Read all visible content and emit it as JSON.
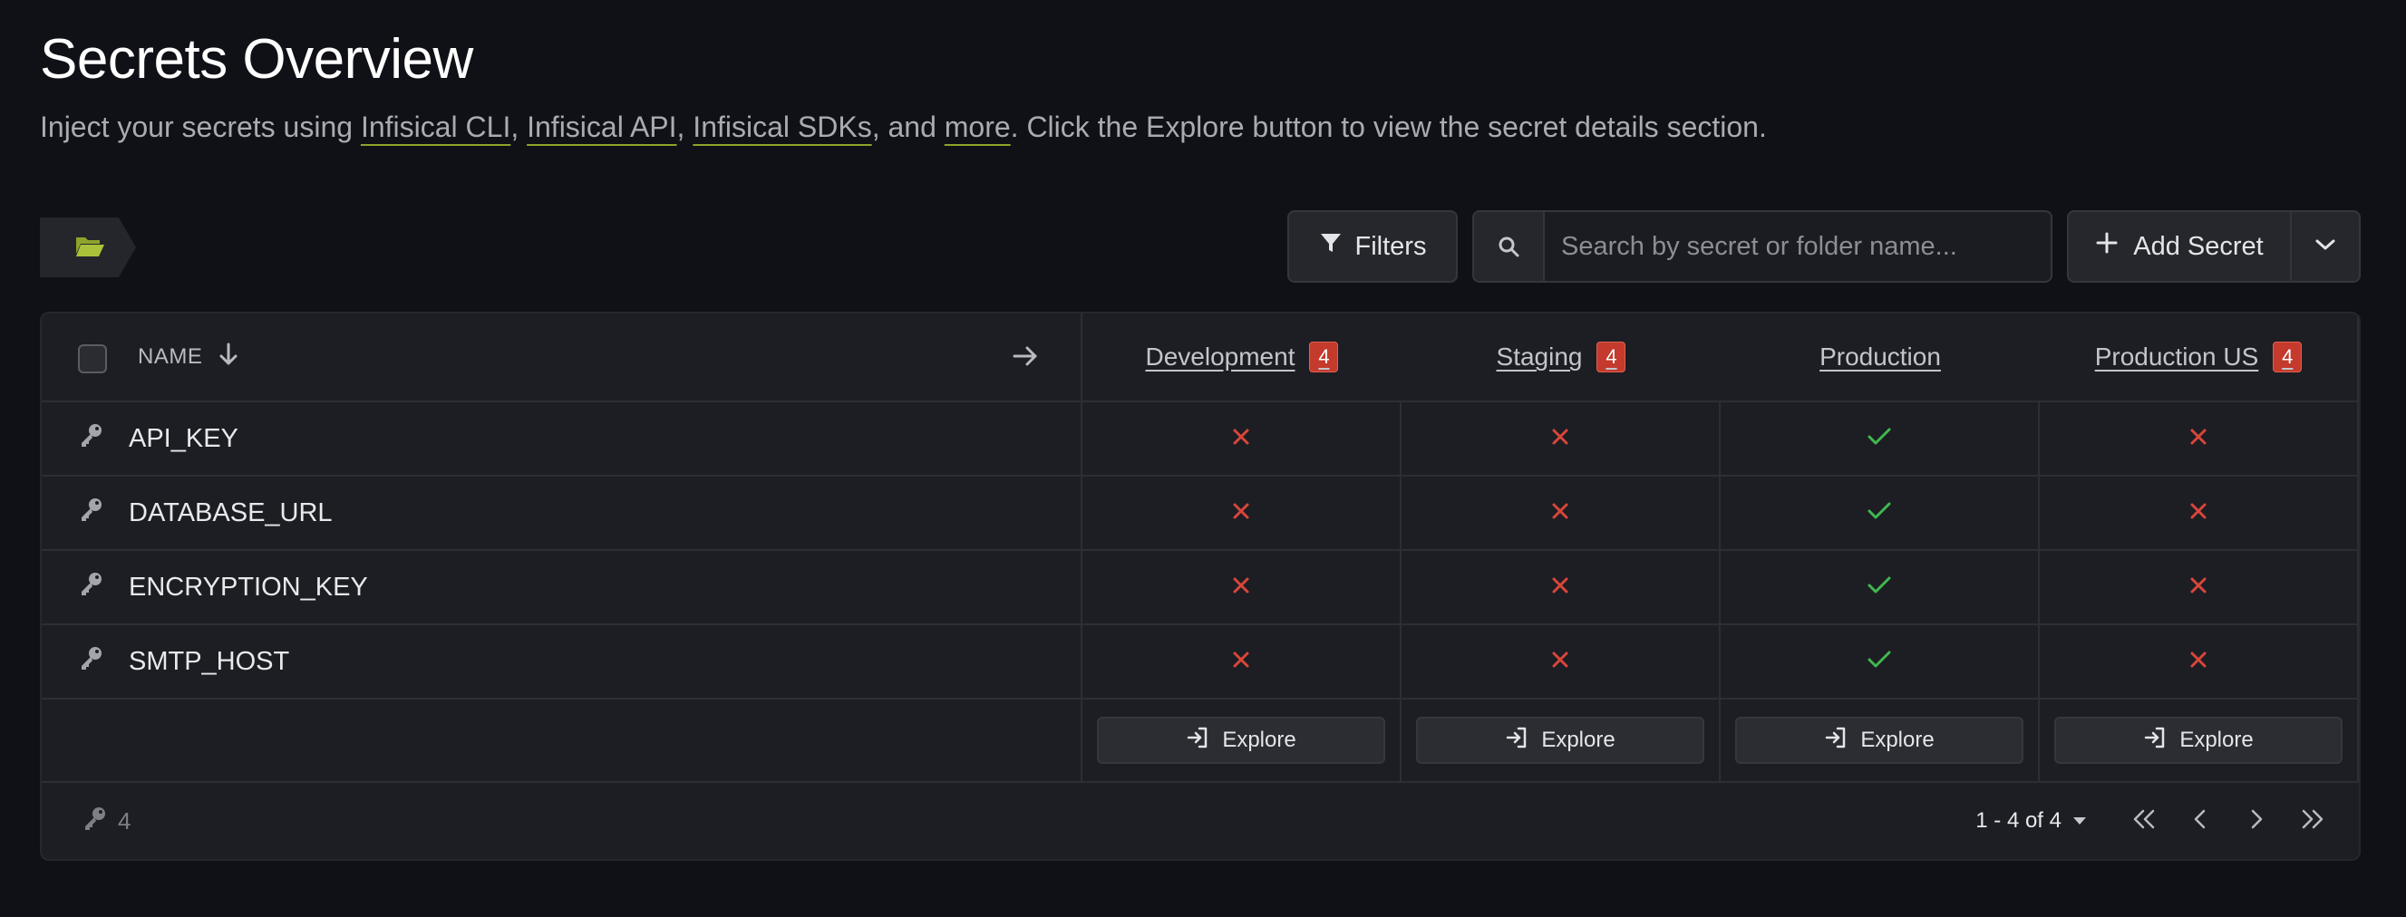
{
  "page": {
    "title": "Secrets Overview",
    "subtitle": {
      "prefix": "Inject your secrets using ",
      "link_cli": "Infisical CLI",
      "sep1": ", ",
      "link_api": "Infisical API",
      "sep2": ", ",
      "link_sdks": "Infisical SDKs",
      "sep3": ", and ",
      "link_more": "more",
      "suffix": ". Click the Explore button to view the secret details section."
    }
  },
  "toolbar": {
    "filters_label": "Filters",
    "search_placeholder": "Search by secret or folder name...",
    "add_secret_label": "Add Secret"
  },
  "table": {
    "name_header": "NAME",
    "environments": [
      {
        "name": "Development",
        "missing_count": "4"
      },
      {
        "name": "Staging",
        "missing_count": "4"
      },
      {
        "name": "Production",
        "missing_count": null
      },
      {
        "name": "Production US",
        "missing_count": "4"
      }
    ],
    "rows": [
      {
        "name": "API_KEY",
        "present": [
          false,
          false,
          true,
          false
        ]
      },
      {
        "name": "DATABASE_URL",
        "present": [
          false,
          false,
          true,
          false
        ]
      },
      {
        "name": "ENCRYPTION_KEY",
        "present": [
          false,
          false,
          true,
          false
        ]
      },
      {
        "name": "SMTP_HOST",
        "present": [
          false,
          false,
          true,
          false
        ]
      }
    ],
    "explore_label": "Explore"
  },
  "footer": {
    "secret_count": "4",
    "range": "1 - 4 of 4"
  },
  "colors": {
    "accent": "#8fa32c",
    "missing": "#d9463a",
    "present": "#3fb950",
    "badge": "#c43a2c"
  }
}
